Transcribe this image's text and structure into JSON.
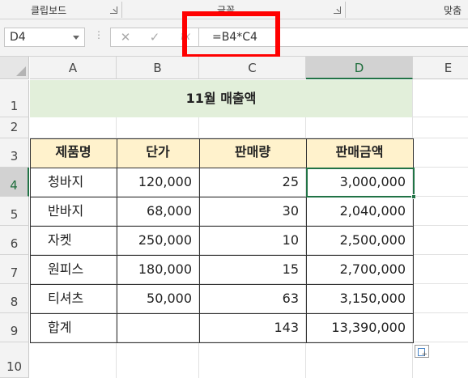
{
  "ribbon": {
    "groups": [
      "클립보드",
      "글꼴",
      "맞춤"
    ]
  },
  "formula_bar": {
    "name_box": "D4",
    "formula": "=B4*C4",
    "cancel_glyph": "✕",
    "enter_glyph": "✓",
    "fx_glyph": "fx"
  },
  "columns": [
    "A",
    "B",
    "C",
    "D",
    "E"
  ],
  "selected_column": "D",
  "rows": [
    "1",
    "2",
    "3",
    "4",
    "5",
    "6",
    "7",
    "8",
    "9",
    "10"
  ],
  "selected_row": "4",
  "selected_cell": "D4",
  "sheet": {
    "title": "11월 매출액",
    "headers": [
      "제품명",
      "단가",
      "판매량",
      "판매금액"
    ],
    "data": [
      {
        "name": "청바지",
        "price": "120,000",
        "qty": "25",
        "amount": "3,000,000"
      },
      {
        "name": "반바지",
        "price": "68,000",
        "qty": "30",
        "amount": "2,040,000"
      },
      {
        "name": "자켓",
        "price": "250,000",
        "qty": "10",
        "amount": "2,500,000"
      },
      {
        "name": "원피스",
        "price": "180,000",
        "qty": "15",
        "amount": "2,700,000"
      },
      {
        "name": "티셔츠",
        "price": "50,000",
        "qty": "63",
        "amount": "3,150,000"
      }
    ],
    "total": {
      "name": "합계",
      "price": "",
      "qty": "143",
      "amount": "13,390,000"
    }
  },
  "colors": {
    "title_fill": "#e2efda",
    "header_fill": "#fff2cc",
    "selection": "#217346",
    "highlight_box": "#ff0000"
  }
}
